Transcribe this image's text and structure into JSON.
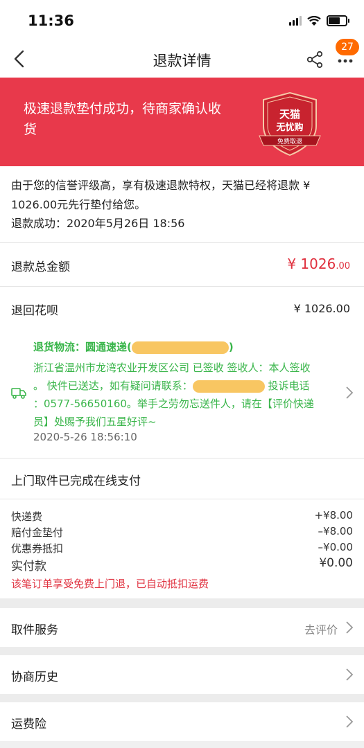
{
  "status_bar": {
    "time": "11:36"
  },
  "nav": {
    "title": "退款详情",
    "badge_count": "27"
  },
  "banner": {
    "text": "极速退款垫付成功，待商家确认收货",
    "seal_line1": "天猫",
    "seal_line2": "无忧购",
    "seal_ribbon": "免费取退"
  },
  "info": {
    "line1": "由于您的信誉评级高，享有极速退款特权，天猫已经将退款 ¥",
    "line2": "1026.00元先行垫付给您。",
    "line3": "退款成功：2020年5月26日 18:56"
  },
  "refund_total": {
    "label": "退款总金额",
    "value": "¥ 1026",
    "cents": ".00"
  },
  "refund_to": {
    "label": "退回花呗",
    "value": "¥ 1026.00"
  },
  "logistics": {
    "title": "退货物流：圆通速递(",
    "title_end": ")",
    "body1": "浙江省温州市龙湾农业开发区公司 已签收 签收人：本人签收",
    "body2_a": "。 快件已送达，如有疑问请联系：",
    "body2_b": " 投诉电话",
    "body3": "：0577-56650160。举手之劳勿忘送件人，请在【评价快递",
    "body4": "员】处赐予我们五星好评~",
    "time": "2020-5-26 18:56:10"
  },
  "pickup": {
    "title": "上门取件已完成在线支付"
  },
  "fees": {
    "items": [
      {
        "label": "快递费",
        "value": "+¥8.00"
      },
      {
        "label": "赔付金垫付",
        "value": "–¥8.00"
      },
      {
        "label": "优惠券抵扣",
        "value": "–¥0.00"
      }
    ],
    "actual_label": "实付款",
    "actual_value": "¥0.00",
    "note": "该笔订单享受免费上门退，已自动抵扣运费"
  },
  "menu": {
    "pickup_service": "取件服务",
    "pickup_action": "去评价",
    "history": "协商历史",
    "insurance": "运费险"
  },
  "colors": {
    "banner": "#e8394b",
    "accent_red": "#e0313f",
    "logistics_green": "#39b54a",
    "badge": "#ff6a00"
  }
}
